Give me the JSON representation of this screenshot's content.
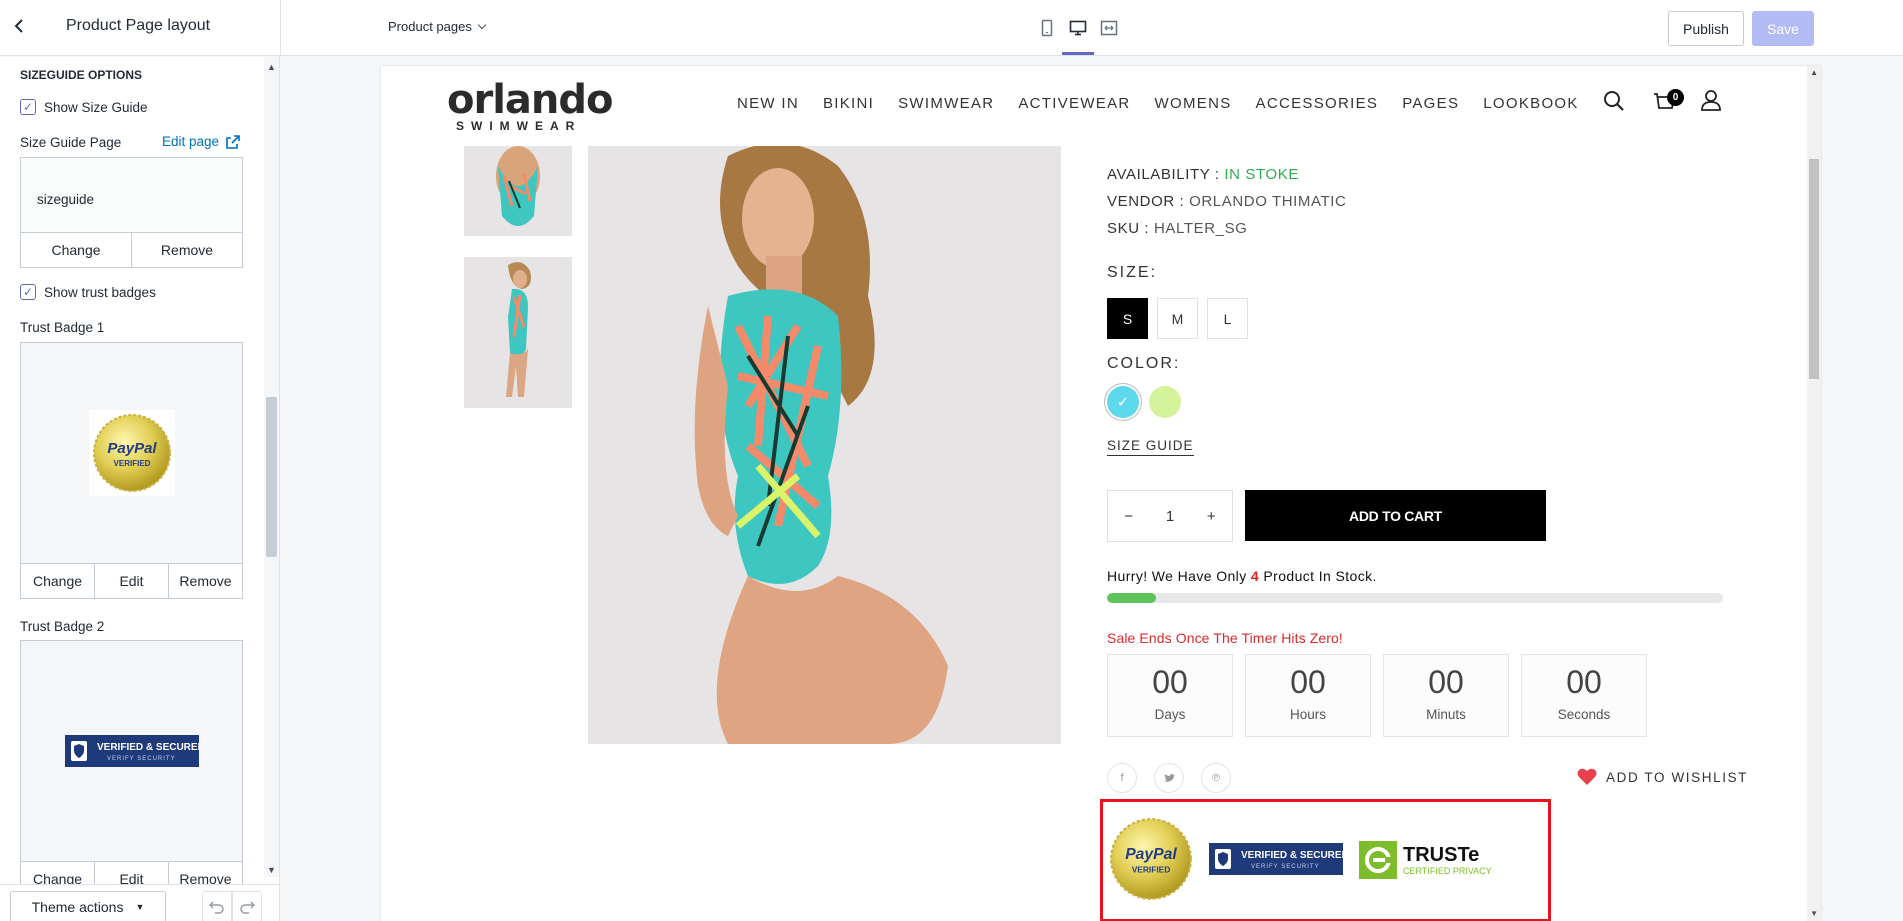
{
  "topbar": {
    "title": "Product Page layout",
    "page_selector": "Product pages",
    "publish_label": "Publish",
    "save_label": "Save"
  },
  "sidebar": {
    "section_title": "SIZEGUIDE OPTIONS",
    "show_size_guide": "Show Size Guide",
    "size_guide_page_label": "Size Guide Page",
    "edit_page_link": "Edit page",
    "size_guide_value": "sizeguide",
    "change": "Change",
    "remove": "Remove",
    "edit": "Edit",
    "show_trust_badges": "Show trust badges",
    "trust_badge_1": "Trust Badge 1",
    "trust_badge_2": "Trust Badge 2",
    "theme_actions": "Theme actions"
  },
  "store": {
    "logo": "orlando",
    "logo_sub": "SWIMWEAR",
    "nav": [
      "NEW IN",
      "BIKINI",
      "SWIMWEAR",
      "ACTIVEWEAR",
      "WOMENS",
      "ACCESSORIES",
      "PAGES",
      "LOOKBOOK"
    ],
    "cart_count": "0"
  },
  "product": {
    "availability_label": "AVAILABILITY :",
    "availability_value": "IN STOKE",
    "vendor_label": "VENDOR :",
    "vendor_value": "ORLANDO THIMATIC",
    "sku_label": "SKU :",
    "sku_value": "HALTER_SG",
    "size_title": "SIZE:",
    "sizes": [
      "S",
      "M",
      "L"
    ],
    "color_title": "COLOR:",
    "colors": [
      "#5cd9ea",
      "#d4f39a"
    ],
    "size_guide_link": "SIZE GUIDE",
    "quantity": "1",
    "add_to_cart": "ADD TO CART",
    "hurry_prefix": "Hurry! We Have Only",
    "hurry_count": "4",
    "hurry_suffix": "Product In Stock.",
    "stock_progress_percent": 8,
    "sale_text": "Sale Ends Once The Timer Hits Zero!",
    "timer": [
      {
        "value": "00",
        "unit": "Days"
      },
      {
        "value": "00",
        "unit": "Hours"
      },
      {
        "value": "00",
        "unit": "Minuts"
      },
      {
        "value": "00",
        "unit": "Seconds"
      }
    ],
    "wishlist": "ADD TO WISHLIST"
  },
  "badges": {
    "paypal_top": "PayPal",
    "paypal_bottom": "VERIFIED",
    "verified_top": "VERIFIED & SECURED",
    "verified_bottom": "VERIFY SECURITY",
    "truste_name": "TRUSTe",
    "truste_sub": "CERTIFIED PRIVACY"
  },
  "colors": {
    "accent": "#5c6ac4",
    "highlight_frame": "#e3141e",
    "in_stock": "#2eac4e",
    "progress": "#5ec35a"
  }
}
